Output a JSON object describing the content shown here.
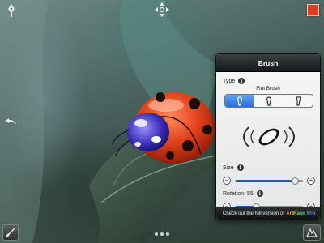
{
  "canvas": {
    "icons": {
      "pen": "pen-nib-icon",
      "move": "move-arrows-icon",
      "undo": "undo-arrow-icon",
      "brush_tool": "brush-icon",
      "more": "more-icon"
    },
    "current_color": "#e23a1c"
  },
  "brush_panel": {
    "title": "Brush",
    "type": {
      "label": "Type",
      "selected_name": "Flat Brush",
      "options": [
        {
          "icon": "flat-brush-icon",
          "selected": true
        },
        {
          "icon": "round-brush-icon",
          "selected": false
        },
        {
          "icon": "fan-brush-icon",
          "selected": false
        }
      ]
    },
    "size": {
      "label": "Size",
      "value_fraction": 0.9
    },
    "rotation": {
      "label": "Rotation: 55",
      "value": 55,
      "max": 180
    },
    "promo": {
      "text": "Check out the full version of",
      "product": "ArtRage Pro"
    }
  },
  "accent_color": "#2b6fd5"
}
